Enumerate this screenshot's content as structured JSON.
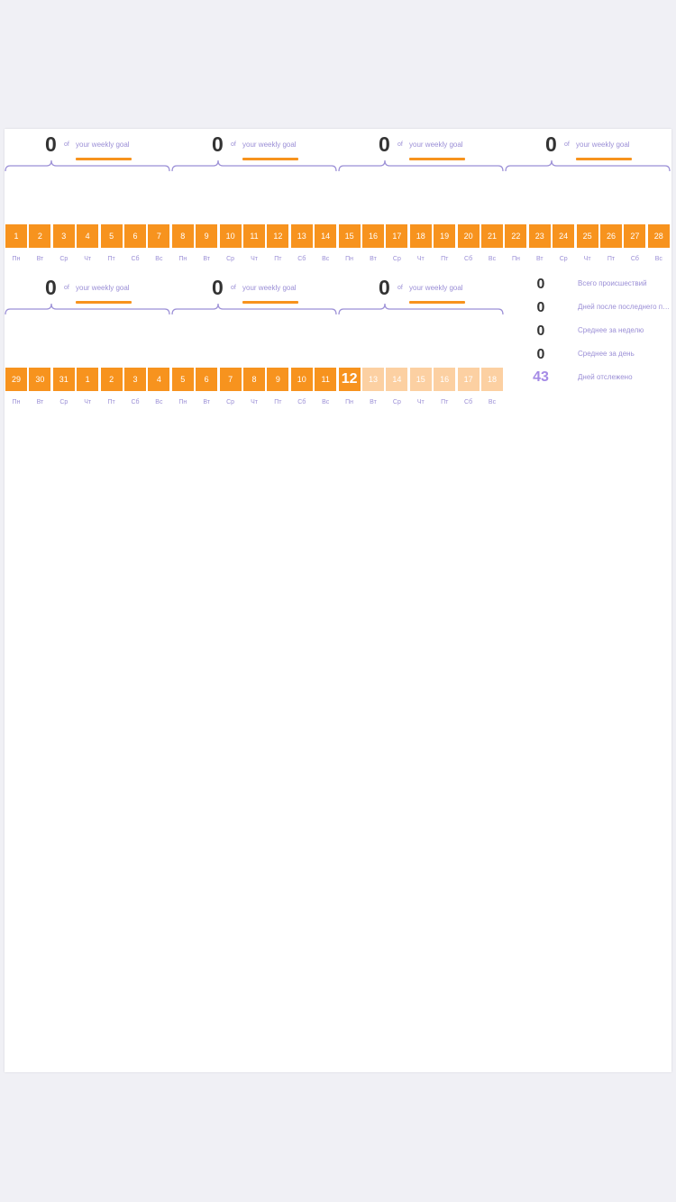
{
  "colors": {
    "background": "#f0f0f5",
    "sheet": "#ffffff",
    "tracked_day": "#f7931e",
    "future_day": "#fcd0a2",
    "accent": "#9b8fd6",
    "number": "#333333"
  },
  "weeks": [
    {
      "goal_value": "0",
      "of_label": "of",
      "goal_label": "your weekly goal"
    },
    {
      "goal_value": "0",
      "of_label": "of",
      "goal_label": "your weekly goal"
    },
    {
      "goal_value": "0",
      "of_label": "of",
      "goal_label": "your weekly goal"
    },
    {
      "goal_value": "0",
      "of_label": "of",
      "goal_label": "your weekly goal"
    },
    {
      "goal_value": "0",
      "of_label": "of",
      "goal_label": "your weekly goal"
    },
    {
      "goal_value": "0",
      "of_label": "of",
      "goal_label": "your weekly goal"
    },
    {
      "goal_value": "0",
      "of_label": "of",
      "goal_label": "your weekly goal"
    }
  ],
  "row1_days": [
    "1",
    "2",
    "3",
    "4",
    "5",
    "6",
    "7",
    "8",
    "9",
    "10",
    "11",
    "12",
    "13",
    "14",
    "15",
    "16",
    "17",
    "18",
    "19",
    "20",
    "21",
    "22",
    "23",
    "24",
    "25",
    "26",
    "27",
    "28"
  ],
  "row2_days": [
    "29",
    "30",
    "31",
    "1",
    "2",
    "3",
    "4",
    "5",
    "6",
    "7",
    "8",
    "9",
    "10",
    "11",
    "12",
    "13",
    "14",
    "15",
    "16",
    "17",
    "18"
  ],
  "today": "12",
  "weekdays": [
    "Пн",
    "Вт",
    "Ср",
    "Чт",
    "Пт",
    "Сб",
    "Вс"
  ],
  "stats": [
    {
      "value": "0",
      "label": "Всего происшествий"
    },
    {
      "value": "0",
      "label": "Дней после последнего происшествия"
    },
    {
      "value": "0",
      "label": "Среднее за неделю"
    },
    {
      "value": "0",
      "label": "Среднее за день"
    },
    {
      "value": "43",
      "label": "Дней отслежено"
    }
  ]
}
